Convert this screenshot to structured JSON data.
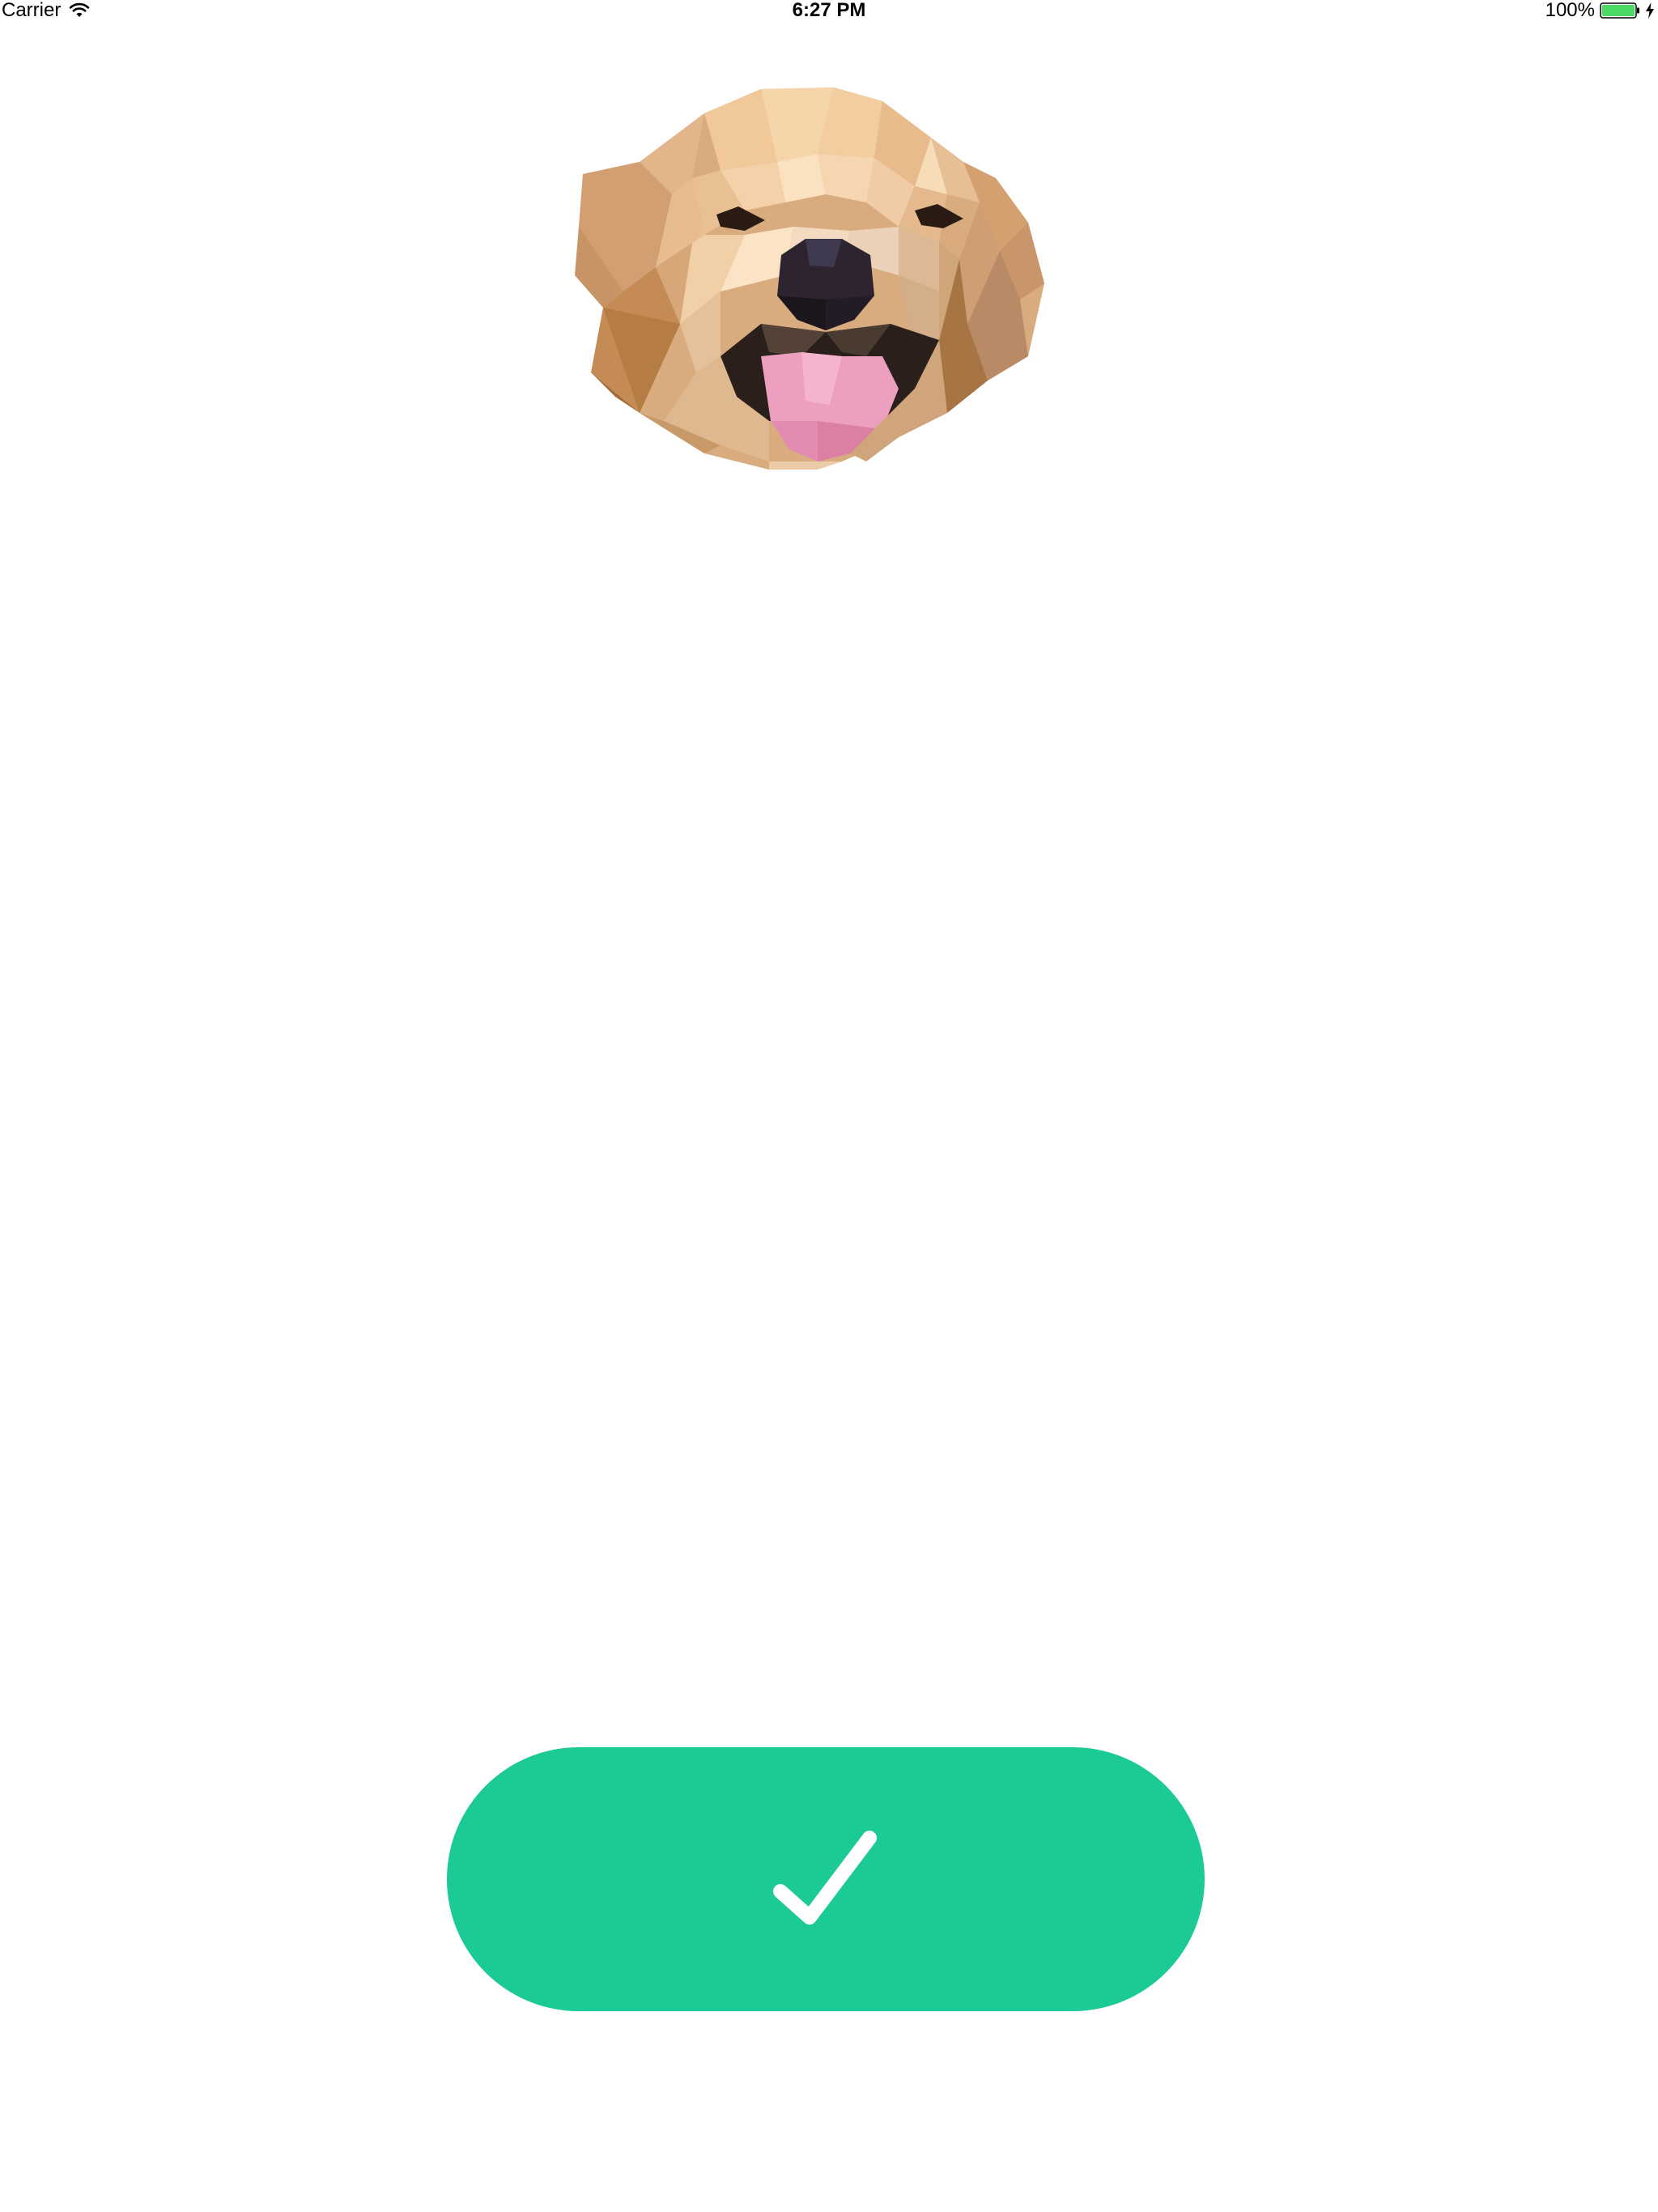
{
  "status_bar": {
    "carrier": "Carrier",
    "time": "6:27 PM",
    "battery_percent": "100%",
    "battery_level": 1.0,
    "battery_color": "#4cd964",
    "icons": [
      "wifi-icon",
      "battery-icon",
      "charging-bolt-icon"
    ]
  },
  "main": {
    "image": {
      "subject": "low-poly golden retriever head",
      "icon": "dog-illustration"
    },
    "confirm_button": {
      "icon": "checkmark-icon",
      "color": "#1bca94",
      "icon_color": "#ffffff"
    }
  },
  "colors": {
    "background": "#ffffff",
    "accent": "#1bca94"
  }
}
